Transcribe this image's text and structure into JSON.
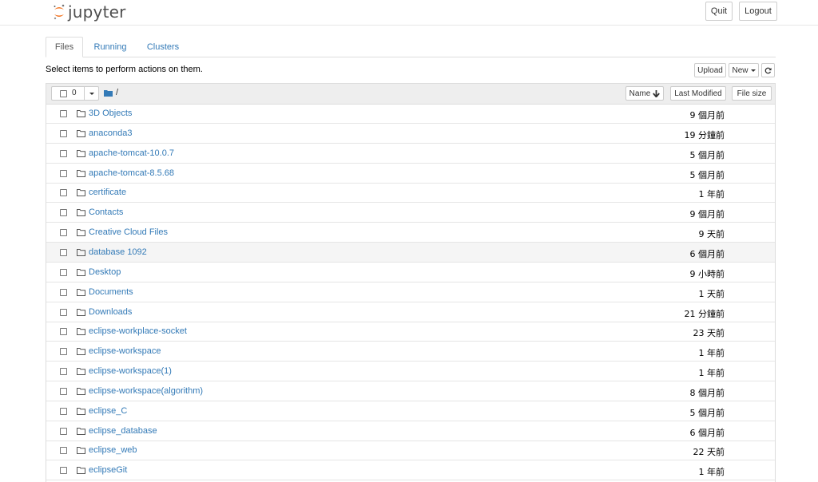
{
  "header": {
    "logo_text": "jupyter",
    "quit_label": "Quit",
    "logout_label": "Logout"
  },
  "tabs": [
    {
      "label": "Files",
      "active": true
    },
    {
      "label": "Running",
      "active": false
    },
    {
      "label": "Clusters",
      "active": false
    }
  ],
  "toolbar": {
    "instructions": "Select items to perform actions on them.",
    "upload_label": "Upload",
    "new_label": "New",
    "refresh_icon": "refresh-icon"
  },
  "list_header": {
    "selected_count": "0",
    "breadcrumb_icon": "folder-solid-icon",
    "breadcrumb_path": "/",
    "sort_name_label": "Name",
    "sort_name_icon": "arrow-down-icon",
    "sort_modified_label": "Last Modified",
    "sort_size_label": "File size"
  },
  "colors": {
    "link": "#337ab7",
    "header_bg": "#eeeeee",
    "logo_orange": "#F37726"
  },
  "files": [
    {
      "name": "3D Objects",
      "modified": "9 個月前"
    },
    {
      "name": "anaconda3",
      "modified": "19 分鐘前"
    },
    {
      "name": "apache-tomcat-10.0.7",
      "modified": "5 個月前"
    },
    {
      "name": "apache-tomcat-8.5.68",
      "modified": "5 個月前"
    },
    {
      "name": "certificate",
      "modified": "1 年前"
    },
    {
      "name": "Contacts",
      "modified": "9 個月前"
    },
    {
      "name": "Creative Cloud Files",
      "modified": "9 天前"
    },
    {
      "name": "database 1092",
      "modified": "6 個月前"
    },
    {
      "name": "Desktop",
      "modified": "9 小時前"
    },
    {
      "name": "Documents",
      "modified": "1 天前"
    },
    {
      "name": "Downloads",
      "modified": "21 分鐘前"
    },
    {
      "name": "eclipse-workplace-socket",
      "modified": "23 天前"
    },
    {
      "name": "eclipse-workspace",
      "modified": "1 年前"
    },
    {
      "name": "eclipse-workspace(1)",
      "modified": "1 年前"
    },
    {
      "name": "eclipse-workspace(algorithm)",
      "modified": "8 個月前"
    },
    {
      "name": "eclipse_C",
      "modified": "5 個月前"
    },
    {
      "name": "eclipse_database",
      "modified": "6 個月前"
    },
    {
      "name": "eclipse_web",
      "modified": "22 天前"
    },
    {
      "name": "eclipseGit",
      "modified": "1 年前"
    }
  ]
}
